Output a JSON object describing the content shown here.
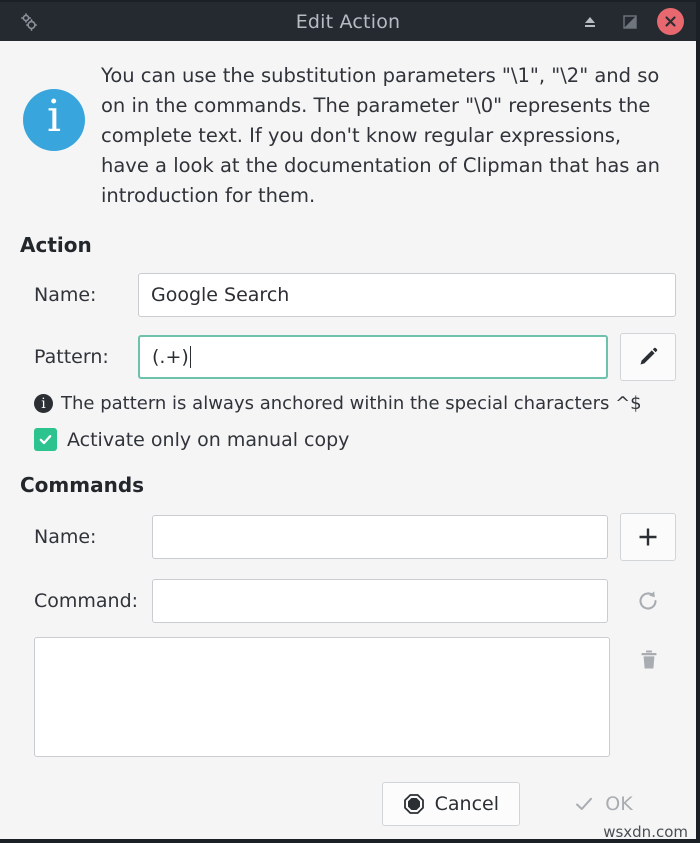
{
  "window": {
    "title": "Edit Action",
    "left_icon": "gears-icon",
    "buttons": [
      {
        "name": "shade-icon",
        "glyph": "⏏"
      },
      {
        "name": "maximize-icon",
        "glyph": "◩"
      },
      {
        "name": "close-icon",
        "glyph": "✕"
      }
    ]
  },
  "info": {
    "icon": "info-icon",
    "glyph": "i",
    "text": "You can use the substitution parameters \"\\1\", \"\\2\" and so on in the commands. The parameter \"\\0\" represents the complete text. If you don't know regular expressions, have a look at the documentation of Clipman that has an introduction for them."
  },
  "action": {
    "section_title": "Action",
    "name_label": "Name:",
    "name_value": "Google Search",
    "name_placeholder": "",
    "pattern_label": "Pattern:",
    "pattern_value": "(.+)",
    "pattern_placeholder": "",
    "edit_button": "pencil-icon",
    "edit_glyph": "✎",
    "hint_icon": "info-icon-small",
    "hint_glyph": "i",
    "hint_text": "The pattern is always anchored within the special characters ^$",
    "checkbox_label": "Activate only on manual copy",
    "checkbox_checked": "✔"
  },
  "commands": {
    "section_title": "Commands",
    "name_label": "Name:",
    "name_value": "",
    "name_placeholder": "",
    "command_label": "Command:",
    "command_value": "",
    "command_placeholder": "",
    "add_button": "plus-icon",
    "add_glyph": "＋",
    "refresh_button": "refresh-icon",
    "refresh_glyph": "⟳",
    "delete_button": "trash-icon",
    "list_value": ""
  },
  "footer": {
    "cancel_label": "Cancel",
    "cancel_icon": "stop-icon",
    "ok_label": "OK",
    "ok_icon": "check-icon",
    "ok_glyph": "✓",
    "watermark": "wsxdn.com"
  },
  "colors": {
    "titlebar": "#252a31",
    "close": "#e8686f",
    "info_blue": "#39a5dd",
    "accent_green": "#2dc38f",
    "focus_border": "#6cc2ab",
    "background": "#f5f5f5"
  }
}
